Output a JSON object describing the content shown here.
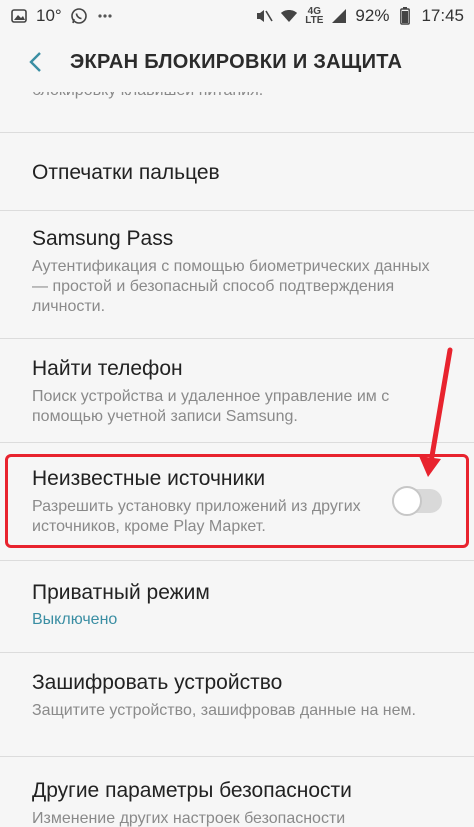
{
  "statusbar": {
    "temperature": "10°",
    "network_top": "4G",
    "network_bottom": "LTE",
    "battery": "92%",
    "time": "17:45"
  },
  "header": {
    "title": "ЭКРАН БЛОКИРОВКИ И ЗАЩИТА"
  },
  "partial_text": "блокировку клавишей питания.",
  "items": [
    {
      "title": "Отпечатки пальцев"
    },
    {
      "title": "Samsung Pass",
      "desc": "Аутентификация с помощью биометрических данных — простой и безопасный способ подтверждения личности."
    },
    {
      "title": "Найти телефон",
      "desc": "Поиск устройства и удаленное управление им с помощью учетной записи Samsung."
    },
    {
      "title": "Неизвестные источники",
      "desc": "Разрешить установку приложений из других источников, кроме Play Маркет.",
      "toggle_on": false
    },
    {
      "title": "Приватный режим",
      "status": "Выключено"
    },
    {
      "title": "Зашифровать устройство",
      "desc": "Защитите устройство, зашифровав данные на нем."
    },
    {
      "title": "Другие параметры безопасности",
      "desc": "Изменение других настроек безопасности"
    }
  ],
  "colors": {
    "accent": "#3a8ea3",
    "highlight": "#e8232e"
  }
}
